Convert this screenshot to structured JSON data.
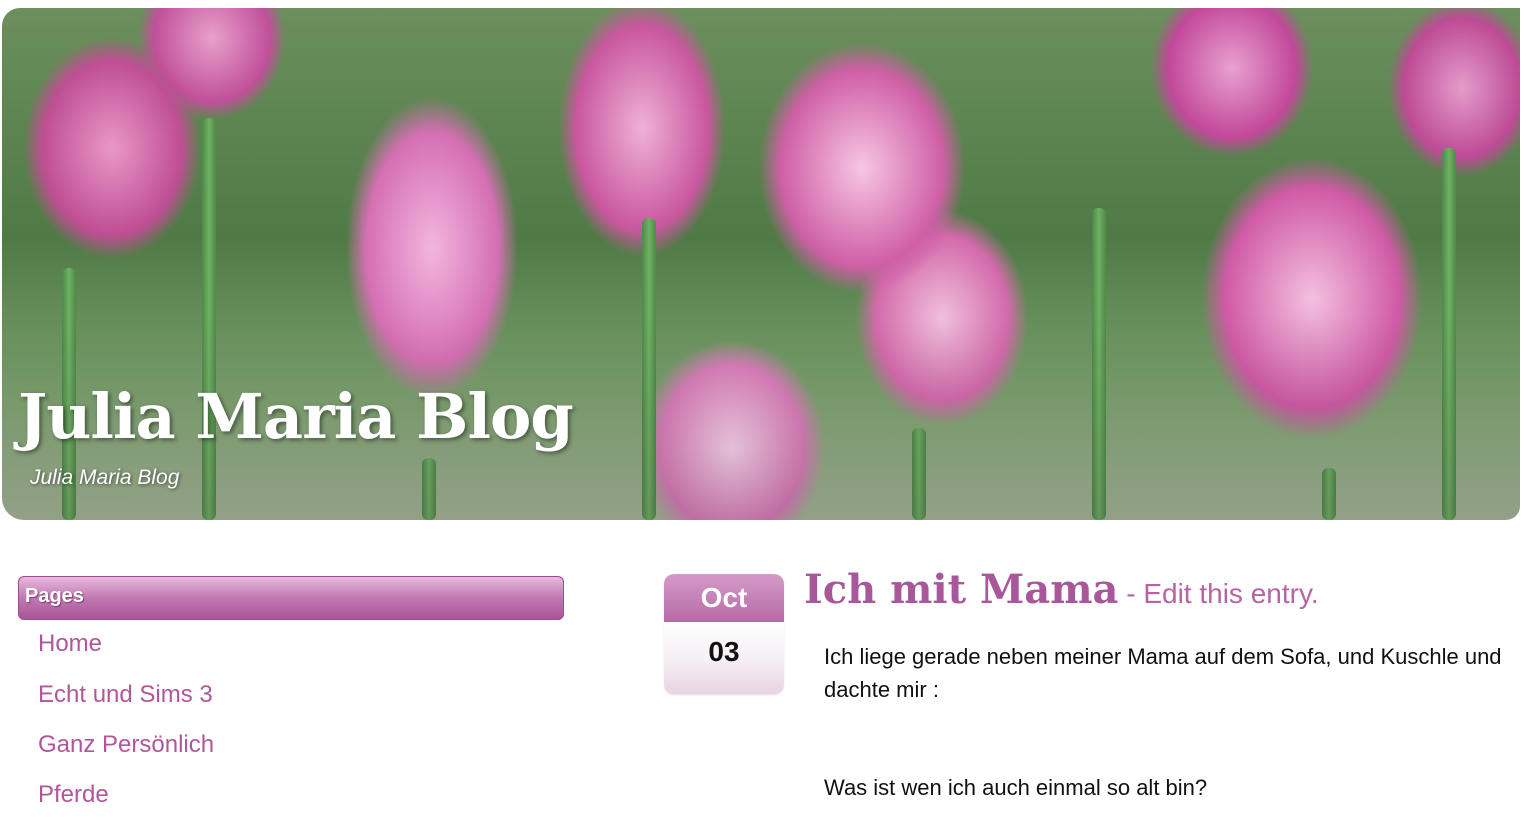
{
  "header": {
    "site_title": "Julia Maria Blog",
    "tagline": "Julia Maria Blog",
    "banner_image": "pink-tulips-banner"
  },
  "sidebar": {
    "heading": "Pages",
    "pages": [
      {
        "label": "Home"
      },
      {
        "label": "Echt und Sims 3"
      },
      {
        "label": "Ganz Persönlich"
      },
      {
        "label": "Pferde"
      }
    ]
  },
  "post": {
    "date": {
      "month": "Oct",
      "day": "03"
    },
    "title": "Ich mit Mama",
    "separator": " - ",
    "edit_link": "Edit this entry.",
    "paragraphs": [
      "Ich liege gerade neben meiner Mama auf dem Sofa, und Kuschle und dachte mir :",
      "Was ist wen ich auch einmal so alt bin?"
    ]
  },
  "colors": {
    "link": "#b2569b",
    "title": "#a8579b",
    "sidebar_header": "#b56aa5",
    "text": "#111111"
  }
}
